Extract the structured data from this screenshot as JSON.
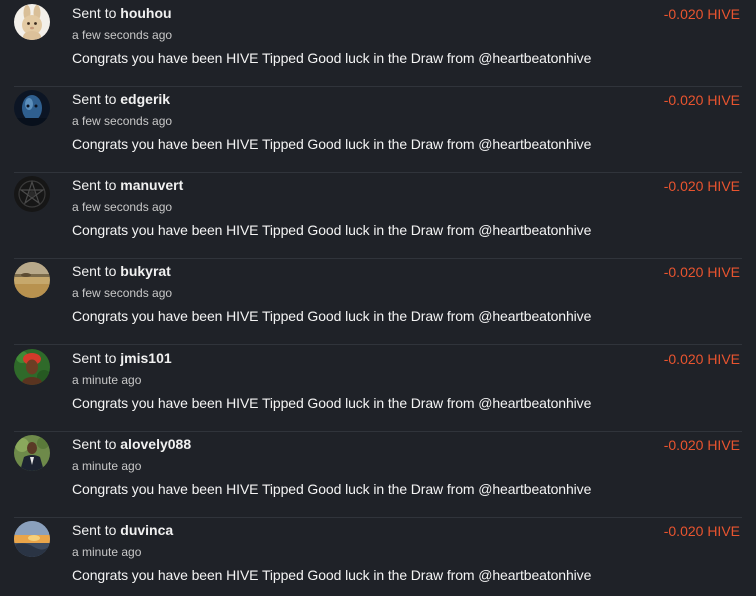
{
  "colors": {
    "background": "#1f2228",
    "amount": "#e8542f",
    "divider": "#30343b"
  },
  "transfers": [
    {
      "prefix": "Sent to",
      "user": "houhou",
      "time": "a few seconds ago",
      "memo": "Congrats you have been HIVE Tipped Good luck in the Draw from @heartbeatonhive",
      "amount": "-0.020 HIVE",
      "avatar": "bunny-avatar"
    },
    {
      "prefix": "Sent to",
      "user": "edgerik",
      "time": "a few seconds ago",
      "memo": "Congrats you have been HIVE Tipped Good luck in the Draw from @heartbeatonhive",
      "amount": "-0.020 HIVE",
      "avatar": "blue-face-avatar"
    },
    {
      "prefix": "Sent to",
      "user": "manuvert",
      "time": "a few seconds ago",
      "memo": "Congrats you have been HIVE Tipped Good luck in the Draw from @heartbeatonhive",
      "amount": "-0.020 HIVE",
      "avatar": "pentagram-avatar"
    },
    {
      "prefix": "Sent to",
      "user": "bukyrat",
      "time": "a few seconds ago",
      "memo": "Congrats you have been HIVE Tipped Good luck in the Draw from @heartbeatonhive",
      "amount": "-0.020 HIVE",
      "avatar": "field-avatar"
    },
    {
      "prefix": "Sent to",
      "user": "jmis101",
      "time": "a minute ago",
      "memo": "Congrats you have been HIVE Tipped Good luck in the Draw from @heartbeatonhive",
      "amount": "-0.020 HIVE",
      "avatar": "woman-portrait-avatar"
    },
    {
      "prefix": "Sent to",
      "user": "alovely088",
      "time": "a minute ago",
      "memo": "Congrats you have been HIVE Tipped Good luck in the Draw from @heartbeatonhive",
      "amount": "-0.020 HIVE",
      "avatar": "man-portrait-avatar"
    },
    {
      "prefix": "Sent to",
      "user": "duvinca",
      "time": "a minute ago",
      "memo": "Congrats you have been HIVE Tipped Good luck in the Draw from @heartbeatonhive",
      "amount": "-0.020 HIVE",
      "avatar": "sunset-avatar"
    }
  ]
}
